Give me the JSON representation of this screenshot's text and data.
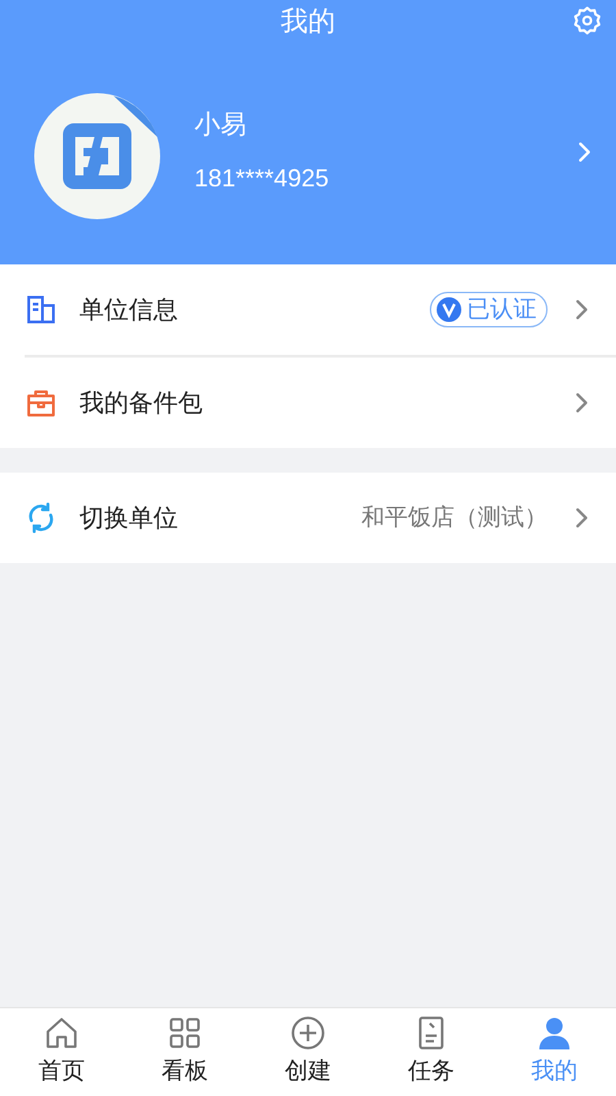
{
  "header": {
    "title": "我的"
  },
  "profile": {
    "name": "小易",
    "phone": "181****4925"
  },
  "groups": [
    [
      {
        "kind": "building",
        "label": "单位信息",
        "badge": "已认证"
      },
      {
        "kind": "bag",
        "label": "我的备件包"
      }
    ],
    [
      {
        "kind": "switch",
        "label": "切换单位",
        "value": "和平饭店（测试）"
      }
    ]
  ],
  "tabs": [
    {
      "kind": "home",
      "label": "首页",
      "selected": false
    },
    {
      "kind": "grid",
      "label": "看板",
      "selected": false
    },
    {
      "kind": "plus",
      "label": "创建",
      "selected": false
    },
    {
      "kind": "task",
      "label": "任务",
      "selected": false
    },
    {
      "kind": "user",
      "label": "我的",
      "selected": true
    }
  ]
}
